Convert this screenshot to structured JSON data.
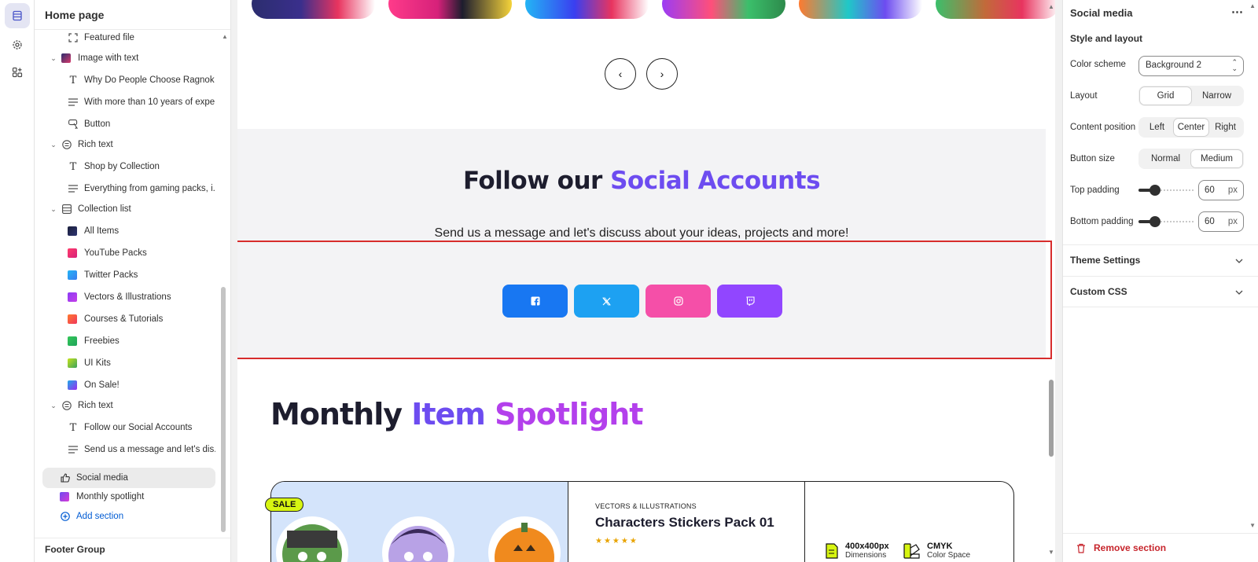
{
  "sidebar": {
    "title": "Home page",
    "items": [
      {
        "label": "Featured file",
        "level": 2,
        "icon": "featured-file-icon"
      },
      {
        "label": "Image with text",
        "level": 1,
        "icon": "image-thumb"
      },
      {
        "label": "Why Do People Choose Ragnok ...",
        "level": 2,
        "icon": "text-icon"
      },
      {
        "label": "With more than 10 years of expe...",
        "level": 2,
        "icon": "paragraph-icon"
      },
      {
        "label": "Button",
        "level": 2,
        "icon": "button-cursor-icon"
      },
      {
        "label": "Rich text",
        "level": 1,
        "icon": "rich-text-icon"
      },
      {
        "label": "Shop by Collection",
        "level": 2,
        "icon": "text-icon"
      },
      {
        "label": "Everything from gaming packs, i...",
        "level": 2,
        "icon": "paragraph-icon"
      },
      {
        "label": "Collection list",
        "level": 1,
        "icon": "collection-list-icon"
      },
      {
        "label": "All Items",
        "level": 2,
        "icon": "thumb"
      },
      {
        "label": "YouTube Packs",
        "level": 2,
        "icon": "thumb"
      },
      {
        "label": "Twitter Packs",
        "level": 2,
        "icon": "thumb"
      },
      {
        "label": "Vectors & Illustrations",
        "level": 2,
        "icon": "thumb"
      },
      {
        "label": "Courses & Tutorials",
        "level": 2,
        "icon": "thumb"
      },
      {
        "label": "Freebies",
        "level": 2,
        "icon": "thumb"
      },
      {
        "label": "UI Kits",
        "level": 2,
        "icon": "thumb"
      },
      {
        "label": "On Sale!",
        "level": 2,
        "icon": "thumb"
      },
      {
        "label": "Rich text",
        "level": 1,
        "icon": "rich-text-icon"
      },
      {
        "label": "Follow our Social Accounts",
        "level": 2,
        "icon": "text-icon"
      },
      {
        "label": "Send us a message and let's dis...",
        "level": 2,
        "icon": "paragraph-icon"
      },
      {
        "label": "Social media",
        "level": 1,
        "icon": "thumbs-up-icon"
      },
      {
        "label": "Monthly spotlight",
        "level": 1,
        "icon": "spotlight-thumb"
      },
      {
        "label": "Add section",
        "level": 1,
        "icon": "plus-circle-icon"
      }
    ],
    "footer_group": "Footer Group"
  },
  "preview": {
    "social_title_dark": "Follow our",
    "social_title_colored": "Social Accounts",
    "social_subtitle": "Send us a message and let's discuss about your ideas, projects and more!",
    "spotlight_dark": "Monthly",
    "spotlight_colored1": "Item",
    "spotlight_colored2": "Spotlight",
    "sale_badge": "SALE",
    "product_category": "VECTORS & ILLUSTRATIONS",
    "product_title": "Characters Stickers Pack 01",
    "product_stars": "★★★★★",
    "spec1_title": "400x400px",
    "spec1_sub": "Dimensions",
    "spec2_title": "CMYK",
    "spec2_sub": "Color Space",
    "social_buttons": [
      {
        "name": "facebook",
        "color": "#1877f2"
      },
      {
        "name": "x-twitter",
        "color": "#1da1f2"
      },
      {
        "name": "instagram",
        "color": "#f54fa8"
      },
      {
        "name": "twitch",
        "color": "#9146ff"
      }
    ]
  },
  "panel": {
    "title": "Social media",
    "more": "⋯",
    "section_label": "Style and layout",
    "color_scheme_label": "Color scheme",
    "color_scheme_value": "Background 2",
    "layout_label": "Layout",
    "layout_options": [
      "Grid",
      "Narrow"
    ],
    "layout_selected": "Grid",
    "content_position_label": "Content position",
    "content_position_options": [
      "Left",
      "Center",
      "Right"
    ],
    "content_position_selected": "Center",
    "button_size_label": "Button size",
    "button_size_options": [
      "Normal",
      "Medium"
    ],
    "button_size_selected": "Medium",
    "top_padding_label": "Top padding",
    "top_padding_value": "60",
    "bottom_padding_label": "Bottom padding",
    "bottom_padding_value": "60",
    "unit": "px",
    "theme_settings": "Theme Settings",
    "custom_css": "Custom CSS",
    "remove_section": "Remove section"
  },
  "colors": {
    "accent_purple": "#7c3aed",
    "accent_pink": "#b340ec",
    "selection_red": "#d72c2c",
    "link_blue": "#005bd3"
  }
}
